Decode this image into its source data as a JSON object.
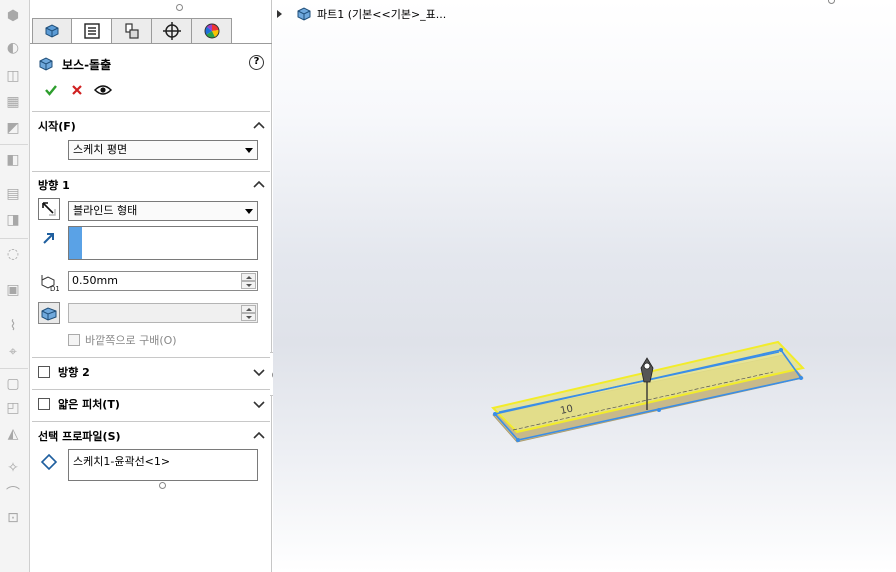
{
  "property_manager": {
    "tabs": [
      {
        "name": "feature-manager",
        "icon": "feature-tree-icon"
      },
      {
        "name": "property-manager",
        "icon": "property-list-icon"
      },
      {
        "name": "configuration-manager",
        "icon": "configuration-icon"
      },
      {
        "name": "dimxpert-manager",
        "icon": "crosshair-icon"
      },
      {
        "name": "display-manager",
        "icon": "color-wheel-icon"
      }
    ],
    "title": "보스-돌출",
    "help": "?",
    "from": {
      "header": "시작(F)",
      "selected": "스케치 평면"
    },
    "direction1": {
      "header": "방향 1",
      "end_condition": "블라인드 형태",
      "distance": "0.50mm",
      "draft_value": "",
      "outward_label": "바깥쪽으로 구배(O)"
    },
    "direction2": {
      "header": "방향 2"
    },
    "thin_feature": {
      "header": "얇은 피처(T)"
    },
    "selected_contours": {
      "header": "선택 프로파일(S)",
      "items": [
        "스케치1-윤곽선<1>"
      ]
    }
  },
  "viewport": {
    "tree_label": "파트1  (기본<<기본>_표...",
    "dimension_label": "10",
    "colors": {
      "preview_fill": "#e6e38a",
      "preview_edge": "#f2ec2a",
      "sketch_line": "#3a8ee8",
      "solid_side": "#c8b98a"
    }
  }
}
